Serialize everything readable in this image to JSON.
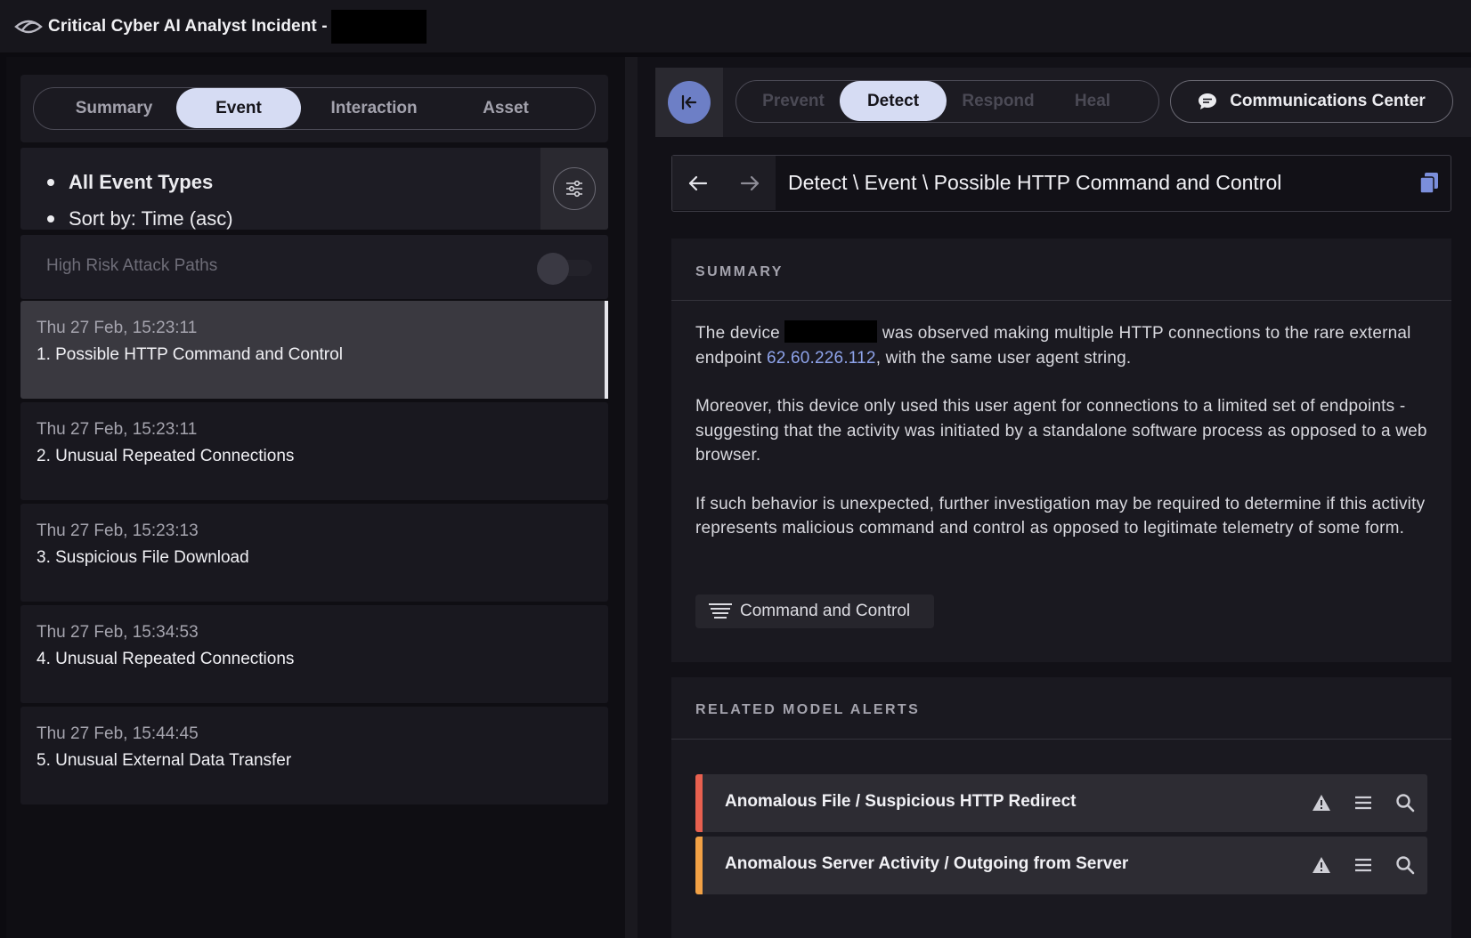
{
  "window": {
    "title": "Critical Cyber AI Analyst Incident -"
  },
  "left": {
    "tabs": [
      "Summary",
      "Event",
      "Interaction",
      "Asset"
    ],
    "active_tab": "Event",
    "filters": {
      "event_types": "All Event Types",
      "sort": "Sort by: Time (asc)"
    },
    "high_risk_label": "High Risk Attack Paths",
    "high_risk_enabled": false,
    "events": [
      {
        "time": "Thu 27 Feb, 15:23:11",
        "name": "1. Possible HTTP Command and Control",
        "selected": true
      },
      {
        "time": "Thu 27 Feb, 15:23:11",
        "name": "2. Unusual Repeated Connections",
        "selected": false
      },
      {
        "time": "Thu 27 Feb, 15:23:13",
        "name": "3. Suspicious File Download",
        "selected": false
      },
      {
        "time": "Thu 27 Feb, 15:34:53",
        "name": "4. Unusual Repeated Connections",
        "selected": false
      },
      {
        "time": "Thu 27 Feb, 15:44:45",
        "name": "5. Unusual External Data Transfer",
        "selected": false
      }
    ]
  },
  "right": {
    "phases": [
      "Prevent",
      "Detect",
      "Respond",
      "Heal"
    ],
    "active_phase": "Detect",
    "comm_center": "Communications Center",
    "breadcrumb": "Detect \\ Event \\ Possible HTTP Command and Control",
    "summary": {
      "heading": "SUMMARY",
      "p1_before": "The device",
      "p1_after": "was observed making multiple HTTP connections to the rare external endpoint",
      "ip": "62.60.226.112",
      "p1_end": ", with the same user agent string.",
      "p2": "Moreover, this device only used this user agent for connections to a limited set of endpoints - suggesting that the activity was initiated by a standalone software process as opposed to a web browser.",
      "p3": "If such behavior is unexpected, further investigation may be required to determine if this activity represents malicious command and control as opposed to legitimate telemetry of some form.",
      "tag": "Command and Control"
    },
    "alerts": {
      "heading": "RELATED MODEL ALERTS",
      "items": [
        {
          "name": "Anomalous File / Suspicious HTTP Redirect",
          "color": "#e8604f"
        },
        {
          "name": "Anomalous Server Activity / Outgoing from Server",
          "color": "#f2a145"
        }
      ]
    }
  },
  "colors": {
    "accent": "#d6dcf3",
    "link": "#8ea3ea",
    "collapse_button": "#6d7fc6"
  }
}
